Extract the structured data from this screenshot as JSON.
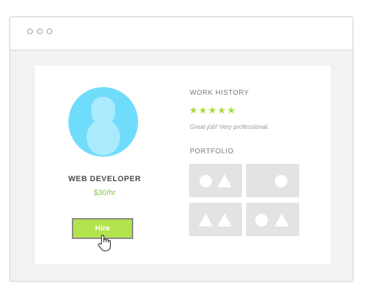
{
  "browser": {
    "window_dots": [
      "circle-icon",
      "circle-icon",
      "circle-icon"
    ]
  },
  "profile": {
    "avatar_icon": "user-avatar-icon",
    "title": "WEB DEVELOPER",
    "rate": "$30/hr",
    "hire_label": "Hire",
    "cursor_icon": "hand-pointer-icon"
  },
  "work_history": {
    "heading": "WORK HISTORY",
    "rating": 5,
    "rating_max": 5,
    "stars": "★★★★★",
    "review": "Great job! Very professional."
  },
  "portfolio": {
    "heading": "PORTFOLIO",
    "thumbnails": [
      {
        "shapes": [
          "circle",
          "triangle"
        ]
      },
      {
        "shapes": [
          "circle"
        ]
      },
      {
        "shapes": [
          "triangle",
          "triangle"
        ]
      },
      {
        "shapes": [
          "circle",
          "triangle"
        ]
      }
    ]
  },
  "colors": {
    "accent_green": "#b2e34c",
    "rate_green": "#7ac943",
    "star_green": "#a6dd3e",
    "avatar_blue": "#70dcfb",
    "avatar_figure": "#a9ebfd",
    "placeholder_gray": "#e3e3e3",
    "placeholder_shape": "#ffffff"
  }
}
